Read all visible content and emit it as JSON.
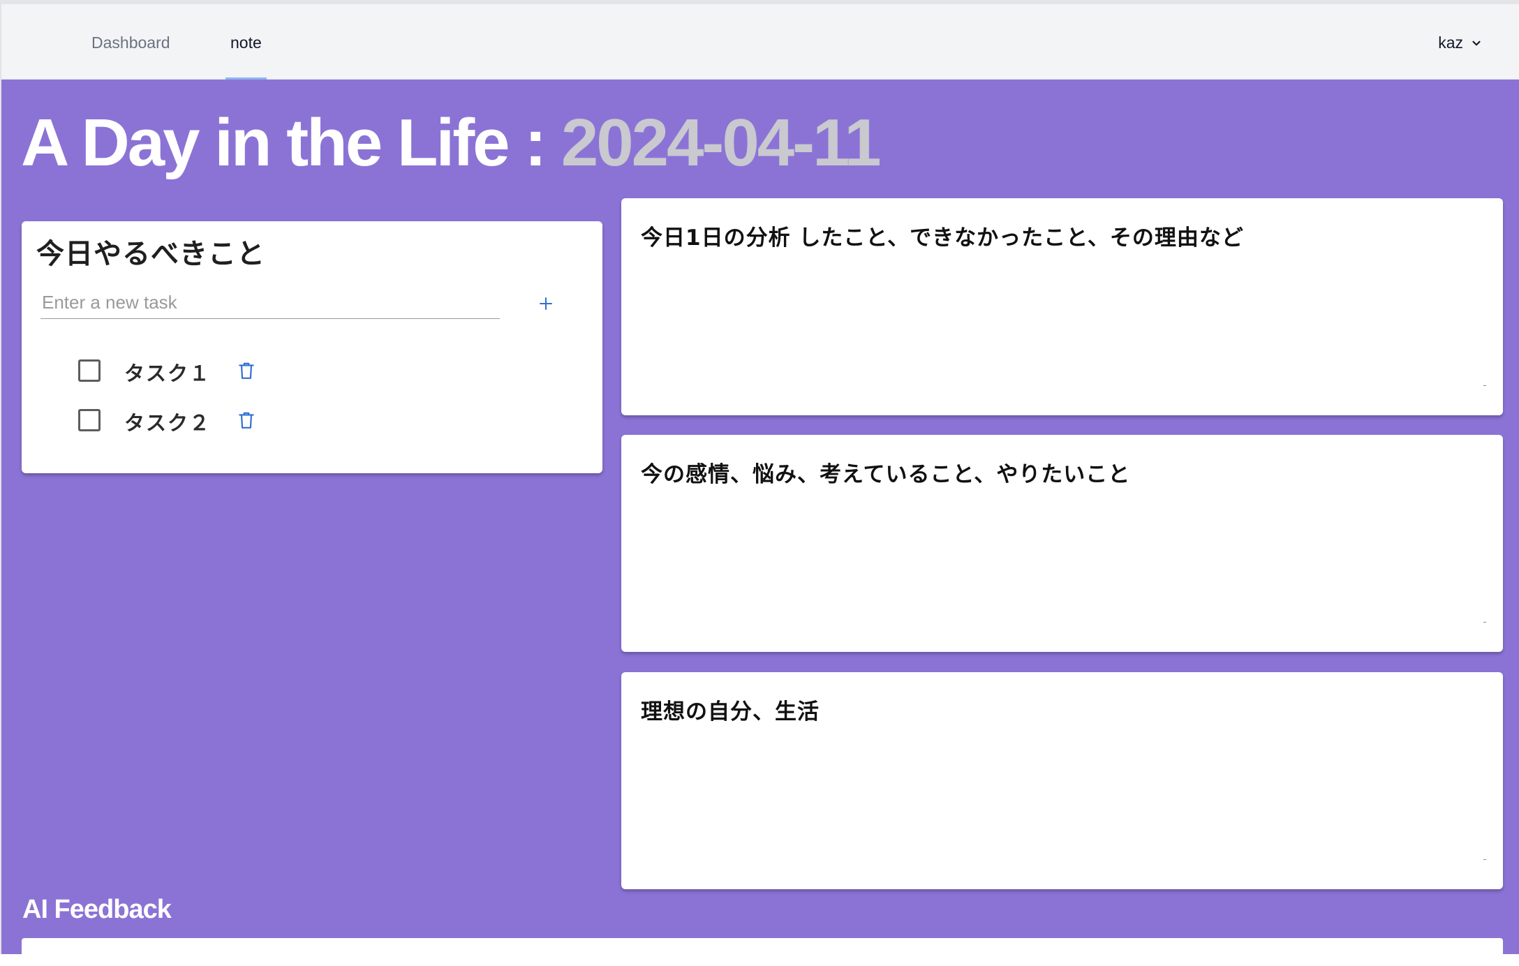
{
  "nav": {
    "links": [
      {
        "label": "Dashboard",
        "active": false
      },
      {
        "label": "note",
        "active": true
      }
    ],
    "user": {
      "name": "kaz",
      "icon": "chevron-down-icon"
    }
  },
  "headline": {
    "title": "A Day in the Life : ",
    "date": "2024-04-11"
  },
  "tasks": {
    "title": "今日やるべきこと",
    "input_placeholder": "Enter a new task",
    "input_value": "",
    "add_icon": "plus-icon",
    "items": [
      {
        "label": "タスク１",
        "checked": false
      },
      {
        "label": "タスク２",
        "checked": false
      }
    ],
    "delete_icon": "trash-icon"
  },
  "notes": [
    {
      "heading": "今日1日の分析  したこと、できなかったこと、その理由など",
      "value": ""
    },
    {
      "heading": "今の感情、悩み、考えていること、やりたいこと",
      "value": ""
    },
    {
      "heading": "理想の自分、生活",
      "value": ""
    }
  ],
  "ai_feedback": {
    "heading": "AI Feedback"
  },
  "colors": {
    "background": "#8b73d6",
    "nav_background": "#f3f4f6",
    "accent_blue": "#2f6fd1",
    "headline_date": "#c9c9cf"
  }
}
